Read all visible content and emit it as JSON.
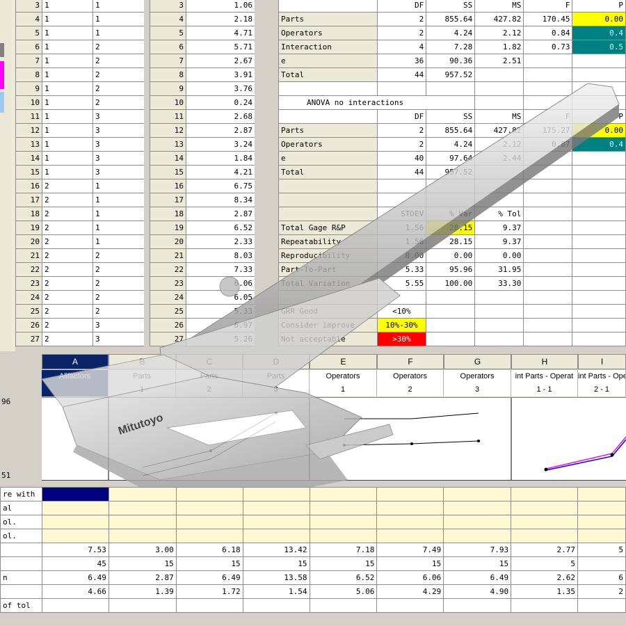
{
  "left_table": {
    "rows": [
      [
        "3",
        "1",
        "1"
      ],
      [
        "4",
        "1",
        "1"
      ],
      [
        "5",
        "1",
        "1"
      ],
      [
        "6",
        "1",
        "2"
      ],
      [
        "7",
        "1",
        "2"
      ],
      [
        "8",
        "1",
        "2"
      ],
      [
        "9",
        "1",
        "2"
      ],
      [
        "10",
        "1",
        "2"
      ],
      [
        "11",
        "1",
        "3"
      ],
      [
        "12",
        "1",
        "3"
      ],
      [
        "13",
        "1",
        "3"
      ],
      [
        "14",
        "1",
        "3"
      ],
      [
        "15",
        "1",
        "3"
      ],
      [
        "16",
        "2",
        "1"
      ],
      [
        "17",
        "2",
        "1"
      ],
      [
        "18",
        "2",
        "1"
      ],
      [
        "19",
        "2",
        "1"
      ],
      [
        "20",
        "2",
        "1"
      ],
      [
        "21",
        "2",
        "2"
      ],
      [
        "22",
        "2",
        "2"
      ],
      [
        "23",
        "2",
        "2"
      ],
      [
        "24",
        "2",
        "2"
      ],
      [
        "25",
        "2",
        "2"
      ],
      [
        "26",
        "2",
        "3"
      ],
      [
        "27",
        "2",
        "3"
      ]
    ]
  },
  "mid_table": {
    "rows": [
      [
        "3",
        "1.06"
      ],
      [
        "4",
        "2.18"
      ],
      [
        "5",
        "4.71"
      ],
      [
        "6",
        "5.71"
      ],
      [
        "7",
        "2.67"
      ],
      [
        "8",
        "3.91"
      ],
      [
        "9",
        "3.76"
      ],
      [
        "10",
        "0.24"
      ],
      [
        "11",
        "2.68"
      ],
      [
        "12",
        "2.87"
      ],
      [
        "13",
        "3.24"
      ],
      [
        "14",
        "1.84"
      ],
      [
        "15",
        "4.21"
      ],
      [
        "16",
        "6.75"
      ],
      [
        "17",
        "8.34"
      ],
      [
        "18",
        "2.87"
      ],
      [
        "19",
        "6.52"
      ],
      [
        "20",
        "2.33"
      ],
      [
        "21",
        "8.03"
      ],
      [
        "22",
        "7.33"
      ],
      [
        "23",
        "6.06"
      ],
      [
        "24",
        "6.05"
      ],
      [
        "25",
        "5.33"
      ],
      [
        "26",
        "6.97"
      ],
      [
        "27",
        "5.26"
      ]
    ]
  },
  "anova": {
    "header": [
      "",
      "DF",
      "SS",
      "MS",
      "F",
      "P"
    ],
    "rows": [
      [
        "Parts",
        "2",
        "855.64",
        "427.82",
        "170.45",
        "0.00"
      ],
      [
        "Operators",
        "2",
        "4.24",
        "2.12",
        "0.84",
        "0.4"
      ],
      [
        "Interaction",
        "4",
        "7.28",
        "1.82",
        "0.73",
        "0.5"
      ],
      [
        "e",
        "36",
        "90.36",
        "2.51",
        "",
        ""
      ],
      [
        "Total",
        "44",
        "957.52",
        "",
        "",
        ""
      ]
    ],
    "no_int_title": "ANOVA no interactions",
    "no_int_header": [
      "",
      "DF",
      "SS",
      "MS",
      "F",
      "P"
    ],
    "no_int_rows": [
      [
        "Parts",
        "2",
        "855.64",
        "427.82",
        "175.27",
        "0.00"
      ],
      [
        "Operators",
        "2",
        "4.24",
        "2.12",
        "0.87",
        "0.4"
      ],
      [
        "e",
        "40",
        "97.64",
        "2.44",
        "",
        ""
      ],
      [
        "Total",
        "44",
        "957.52",
        "",
        "",
        ""
      ]
    ],
    "grr_header": [
      "",
      "STDEV",
      "% Var",
      "% Tol"
    ],
    "grr_rows": [
      [
        "Total Gage R&P",
        "1.56",
        "28.15",
        "9.37"
      ],
      [
        "Repeatability",
        "1.56",
        "28.15",
        "9.37"
      ],
      [
        "Reproducibility",
        "0.00",
        "0.00",
        "0.00"
      ],
      [
        "Part-To-Part",
        "5.33",
        "95.96",
        "31.95"
      ],
      [
        "Total Variation",
        "5.55",
        "100.00",
        "33.30"
      ]
    ],
    "legend": [
      [
        "GRR Good",
        "<10%"
      ],
      [
        "Consider improve",
        "10%-30%"
      ],
      [
        "Not acceptable",
        ">30%"
      ]
    ]
  },
  "sheet": {
    "columns": [
      "A",
      "B",
      "C",
      "D",
      "E",
      "F",
      "G",
      "H",
      "I"
    ],
    "sub1": [
      "Allfactors",
      "Parts",
      "Parts",
      "Parts",
      "Operators",
      "Operators",
      "Operators",
      "int Parts - Operat",
      "int Parts - Ope"
    ],
    "sub2": [
      "",
      "1",
      "2",
      "3",
      "1",
      "2",
      "3",
      "1 - 1",
      "2 - 1"
    ],
    "left_labels": [
      "96",
      "51"
    ]
  },
  "lower": {
    "labels": [
      "re with",
      "al",
      "ol.",
      "ol.",
      "",
      "",
      "n",
      "",
      "of tol"
    ],
    "rows": [
      [
        "7.53",
        "3.00",
        "6.18",
        "13.42",
        "7.18",
        "7.49",
        "7.93",
        "2.77",
        "5"
      ],
      [
        "45",
        "15",
        "15",
        "15",
        "15",
        "15",
        "15",
        "5",
        ""
      ],
      [
        "6.49",
        "2.87",
        "6.49",
        "13.58",
        "6.52",
        "6.06",
        "6.49",
        "2.62",
        "6"
      ],
      [
        "4.66",
        "1.39",
        "1.72",
        "1.54",
        "5.06",
        "4.29",
        "4.90",
        "1.35",
        "2"
      ]
    ]
  },
  "caliper": {
    "brand": "Mitutoyo"
  }
}
